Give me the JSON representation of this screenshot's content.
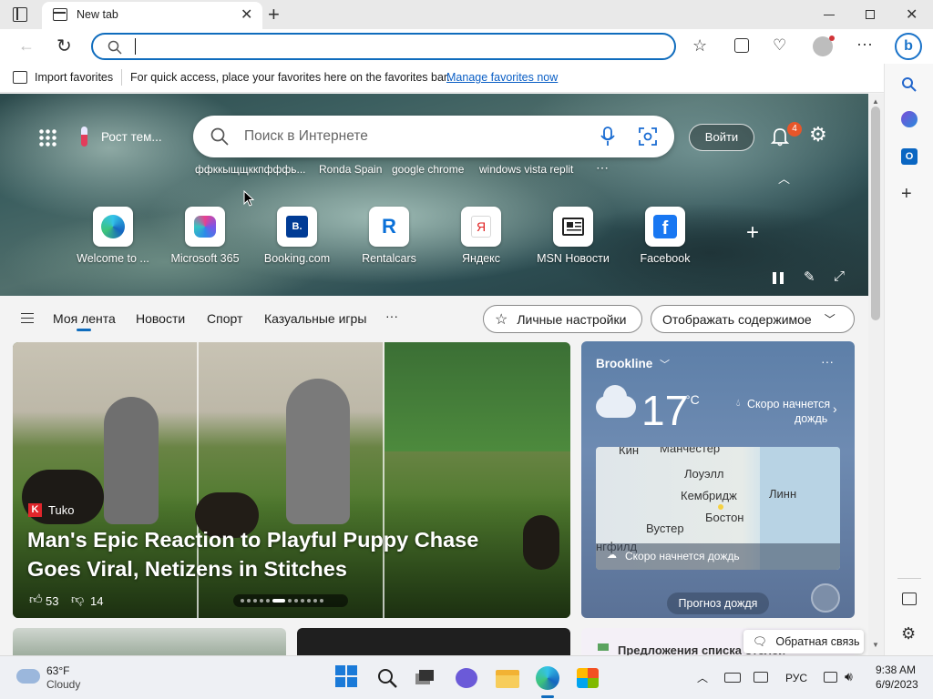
{
  "browser": {
    "tab_title": "New tab",
    "address_value": "",
    "favbar": {
      "import_label": "Import favorites",
      "message": "For quick access, place your favorites here on the favorites bar.",
      "manage_link": "Manage favorites now"
    }
  },
  "newtab": {
    "weather_chip": "Рост тем...",
    "search_placeholder": "Поиск в Интернете",
    "signin_label": "Войти",
    "notification_count": "4",
    "suggestions": [
      "ффккыщщккпфффь...",
      "Ronda Spain",
      "google chrome",
      "windows vista replit"
    ],
    "more_suggestions": "⋯",
    "tiles": [
      {
        "label": "Welcome to ...",
        "icon": "edge-icon"
      },
      {
        "label": "Microsoft 365",
        "icon": "microsoft365-icon"
      },
      {
        "label": "Booking.com",
        "icon": "booking-icon",
        "glyph": "B."
      },
      {
        "label": "Rentalcars",
        "icon": "rentalcars-icon",
        "glyph": "R"
      },
      {
        "label": "Яндекс",
        "icon": "yandex-icon",
        "glyph": "Я"
      },
      {
        "label": "MSN Новости",
        "icon": "msn-news-icon"
      },
      {
        "label": "Facebook",
        "icon": "facebook-icon",
        "glyph": "f"
      }
    ]
  },
  "feed": {
    "tabs": [
      "Моя лента",
      "Новости",
      "Спорт",
      "Казуальные игры"
    ],
    "more": "···",
    "personalize_label": "Личные настройки",
    "display_label": "Отображать содержимое",
    "hero_card": {
      "source": "Tuko",
      "source_logo": "K",
      "title": "Man's Epic Reaction to Playful Puppy Chase Goes Viral, Netizens in Stitches",
      "likes": "53",
      "dislikes": "14",
      "slide_count": 12,
      "active_slide": 5
    },
    "weather_card": {
      "location": "Brookline",
      "temperature": "17",
      "unit": "°C",
      "forecast_line1": "Скоро начнется",
      "forecast_line2": "дождь",
      "map_labels": [
        "Кин",
        "Манчестер",
        "Лоуэлл",
        "Кембридж",
        "Линн",
        "Бостон",
        "Вустер",
        "нгфилд"
      ],
      "map_alert": "Скоро начнется дождь",
      "button_label": "Прогноз дождя",
      "more": "···"
    },
    "bottom_card_text": "Предложения списка отелей",
    "feedback_label": "Обратная связь"
  },
  "taskbar": {
    "weather_temp": "63°F",
    "weather_desc": "Cloudy",
    "language": "РУС",
    "time": "9:38 AM",
    "date": "6/9/2023"
  },
  "colors": {
    "accent": "#0f6cbd",
    "link": "#0a5ec5",
    "badge": "#e8562a"
  }
}
